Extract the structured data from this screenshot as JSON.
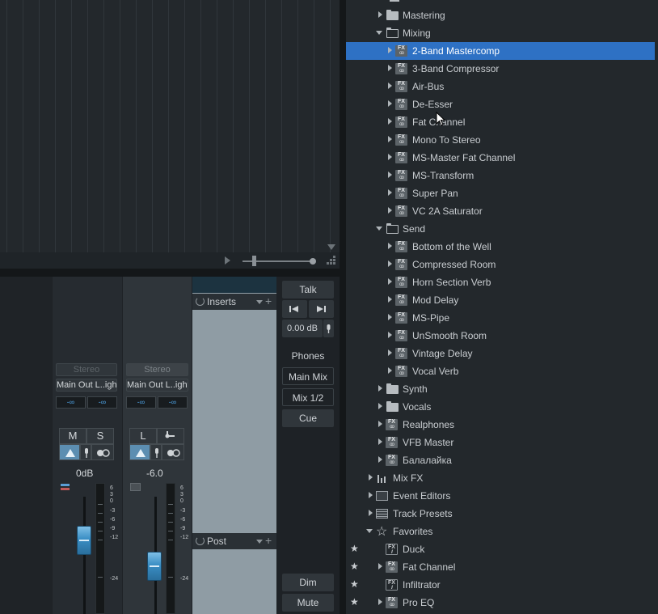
{
  "console": {
    "strip1": {
      "mode_label": "Stereo",
      "output_label": "Main Out L..ight",
      "in_left": "-∞",
      "in_right": "-∞",
      "mute_label": "M",
      "solo_label": "S",
      "gain": "0dB"
    },
    "strip2": {
      "mode_label": "Stereo",
      "output_label": "Main Out L..ight",
      "in_left": "-∞",
      "in_right": "-∞",
      "listen_label": "L",
      "gain": "-6.0"
    },
    "meter_scale": [
      "6",
      "3",
      "0",
      "-3",
      "-6",
      "-9",
      "-12",
      "-24"
    ],
    "inserts_label": "Inserts",
    "post_label": "Post",
    "monitor": {
      "talk": "Talk",
      "level": "0.00 dB",
      "phones": "Phones",
      "main_mix": "Main Mix",
      "mix12": "Mix 1/2",
      "cue": "Cue",
      "dim": "Dim",
      "mute": "Mute"
    }
  },
  "browser": {
    "mastering": "Mastering",
    "mixing": "Mixing",
    "mixing_items": [
      "2-Band Mastercomp",
      "3-Band Compressor",
      "Air-Bus",
      "De-Esser",
      "Fat Channel",
      "Mono To Stereo",
      "MS-Master Fat Channel",
      "MS-Transform",
      "Super Pan",
      "VC 2A Saturator"
    ],
    "send": "Send",
    "send_items": [
      "Bottom of the Well",
      "Compressed Room",
      "Horn Section Verb",
      "Mod Delay",
      "MS-Pipe",
      "UnSmooth Room",
      "Vintage Delay",
      "Vocal Verb"
    ],
    "synth": "Synth",
    "vocals": "Vocals",
    "realphones": "Realphones",
    "vfb_master": "VFB Master",
    "balalaika": "Балалайка",
    "mix_fx": "Mix FX",
    "event_editors": "Event Editors",
    "track_presets": "Track Presets",
    "favorites": "Favorites",
    "favorite_items": [
      "Duck",
      "Fat Channel",
      "Infiltrator",
      "Pro EQ"
    ],
    "fx_badge": "FX",
    "selected": "2-Band Mastercomp"
  }
}
